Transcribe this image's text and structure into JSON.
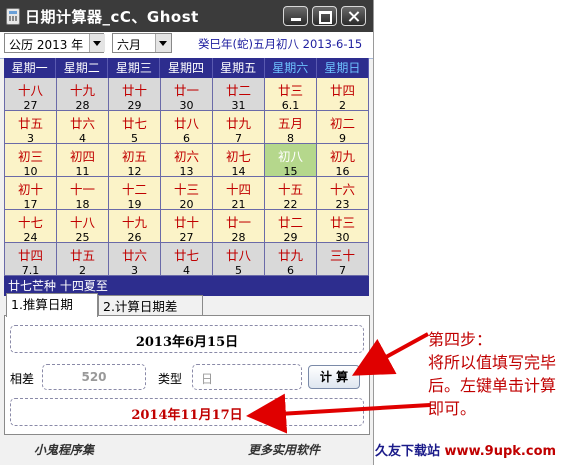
{
  "window": {
    "title": "日期计算器_cC、Ghost"
  },
  "toolbar": {
    "year_select": "公历 2013 年",
    "month_select": "六月",
    "lunar_date": "癸巳年(蛇)五月初八  2013-6-15"
  },
  "calendar": {
    "weekdays": [
      "星期一",
      "星期二",
      "星期三",
      "星期四",
      "星期五",
      "星期六",
      "星期日"
    ],
    "weekend_color": "#6ec2ff",
    "cells": [
      {
        "lunar": "十八",
        "day": "27",
        "other": true
      },
      {
        "lunar": "十九",
        "day": "28",
        "other": true
      },
      {
        "lunar": "廿十",
        "day": "29",
        "other": true
      },
      {
        "lunar": "廿一",
        "day": "30",
        "other": true
      },
      {
        "lunar": "廿二",
        "day": "31",
        "other": true
      },
      {
        "lunar": "廿三",
        "day": "6.1",
        "other": false
      },
      {
        "lunar": "廿四",
        "day": "2",
        "other": false
      },
      {
        "lunar": "廿五",
        "day": "3",
        "other": false
      },
      {
        "lunar": "廿六",
        "day": "4",
        "other": false
      },
      {
        "lunar": "廿七",
        "day": "5",
        "other": false
      },
      {
        "lunar": "廿八",
        "day": "6",
        "other": false
      },
      {
        "lunar": "廿九",
        "day": "7",
        "other": false
      },
      {
        "lunar": "五月",
        "day": "8",
        "other": false
      },
      {
        "lunar": "初二",
        "day": "9",
        "other": false
      },
      {
        "lunar": "初三",
        "day": "10",
        "other": false
      },
      {
        "lunar": "初四",
        "day": "11",
        "other": false
      },
      {
        "lunar": "初五",
        "day": "12",
        "other": false
      },
      {
        "lunar": "初六",
        "day": "13",
        "other": false
      },
      {
        "lunar": "初七",
        "day": "14",
        "other": false
      },
      {
        "lunar": "初八",
        "day": "15",
        "other": false,
        "today": true
      },
      {
        "lunar": "初九",
        "day": "16",
        "other": false
      },
      {
        "lunar": "初十",
        "day": "17",
        "other": false
      },
      {
        "lunar": "十一",
        "day": "18",
        "other": false
      },
      {
        "lunar": "十二",
        "day": "19",
        "other": false
      },
      {
        "lunar": "十三",
        "day": "20",
        "other": false
      },
      {
        "lunar": "十四",
        "day": "21",
        "other": false
      },
      {
        "lunar": "十五",
        "day": "22",
        "other": false
      },
      {
        "lunar": "十六",
        "day": "23",
        "other": false
      },
      {
        "lunar": "十七",
        "day": "24",
        "other": false
      },
      {
        "lunar": "十八",
        "day": "25",
        "other": false
      },
      {
        "lunar": "十九",
        "day": "26",
        "other": false
      },
      {
        "lunar": "廿十",
        "day": "27",
        "other": false
      },
      {
        "lunar": "廿一",
        "day": "28",
        "other": false
      },
      {
        "lunar": "廿二",
        "day": "29",
        "other": false
      },
      {
        "lunar": "廿三",
        "day": "30",
        "other": false
      },
      {
        "lunar": "廿四",
        "day": "7.1",
        "other": true
      },
      {
        "lunar": "廿五",
        "day": "2",
        "other": true
      },
      {
        "lunar": "廿六",
        "day": "3",
        "other": true
      },
      {
        "lunar": "廿七",
        "day": "4",
        "other": true
      },
      {
        "lunar": "廿八",
        "day": "5",
        "other": true
      },
      {
        "lunar": "廿九",
        "day": "6",
        "other": true
      },
      {
        "lunar": "三十",
        "day": "7",
        "other": true
      }
    ],
    "solar_terms": "廿七芒种  十四夏至"
  },
  "tabs": [
    {
      "label": "1.推算日期",
      "active": true
    },
    {
      "label": "2.计算日期差",
      "active": false
    }
  ],
  "form": {
    "base_date": "2013年6月15日",
    "diff_label": "相差",
    "diff_value": "520",
    "type_label": "类型",
    "type_value": "日",
    "calc_button": "计 算",
    "result_date": "2014年11月17日"
  },
  "footer": {
    "left": "小鬼程序集",
    "right": "更多实用软件"
  },
  "annotation": {
    "lines": [
      "第四步：",
      "将所以值填写完毕",
      "后。左键单击计算",
      "即可。"
    ],
    "color": "#c00000"
  },
  "watermark": {
    "brand": "久友下载站",
    "url": "www.9upk.com"
  },
  "colors": {
    "header_bg": "#2d2d8e",
    "cell_bg": "#fbf3c8",
    "other_month_bg": "#d9d9d9",
    "today_bg": "#b5d78c",
    "lunar_text": "#c00000"
  }
}
